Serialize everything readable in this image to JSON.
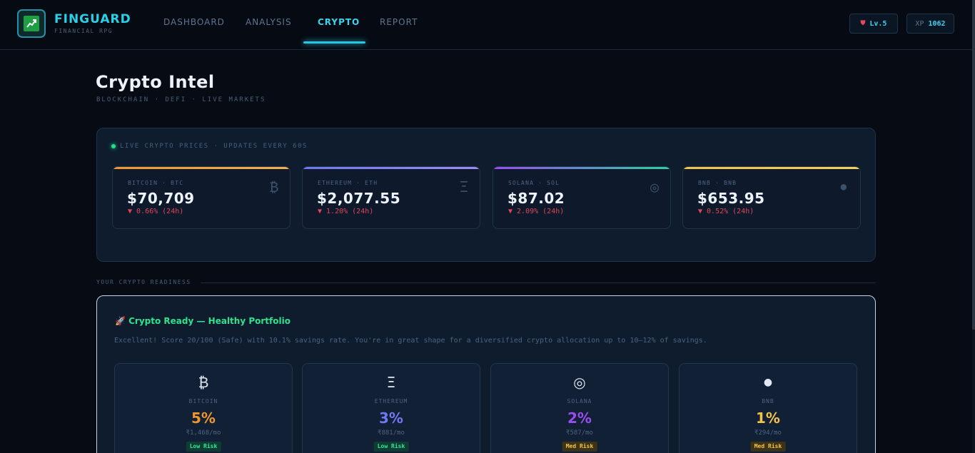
{
  "brand": {
    "name": "FINGUARD",
    "subtitle": "FINANCIAL RPG"
  },
  "nav": {
    "tabs": [
      {
        "label": "DASHBOARD",
        "active": false
      },
      {
        "label": "ANALYSIS",
        "active": false
      },
      {
        "label": "CRYPTO",
        "active": true
      },
      {
        "label": "REPORT",
        "active": false
      }
    ]
  },
  "status": {
    "level": "Lv.5",
    "xp_label": "XP",
    "xp_value": "1062"
  },
  "page": {
    "title": "Crypto Intel",
    "subtitle": "BLOCKCHAIN · DEFI · LIVE MARKETS"
  },
  "live": {
    "label": "LIVE CRYPTO PRICES · UPDATES EVERY 60S",
    "coins": [
      {
        "name": "BITCOIN · BTC",
        "price": "$70,709",
        "change": "▼ 0.66% (24h)",
        "icon": "₿",
        "accent": "#f0962e"
      },
      {
        "name": "ETHEREUM · ETH",
        "price": "$2,077.55",
        "change": "▼ 1.20% (24h)",
        "icon": "Ξ",
        "accent": "#7b74f0"
      },
      {
        "name": "SOLANA · SOL",
        "price": "$87.02",
        "change": "▼ 2.09% (24h)",
        "icon": "◎",
        "accent": "#8b3df0"
      },
      {
        "name": "BNB · BNB",
        "price": "$653.95",
        "change": "▼ 0.52% (24h)",
        "icon": "●",
        "accent": "#f2c24a"
      }
    ]
  },
  "readiness": {
    "section_label": "YOUR CRYPTO READINESS",
    "title": "🚀 Crypto Ready — Healthy Portfolio",
    "description": "Excellent! Score 20/100 (Safe) with 10.1% savings rate. You're in great shape for a diversified crypto allocation up to 10–12% of savings.",
    "allocations": [
      {
        "icon": "₿",
        "name": "BITCOIN",
        "percent": "5%",
        "amount": "₹1,468/mo",
        "risk": "Low Risk",
        "color": "#f0962e"
      },
      {
        "icon": "Ξ",
        "name": "ETHEREUM",
        "percent": "3%",
        "amount": "₹881/mo",
        "risk": "Low Risk",
        "color": "#6f78f0"
      },
      {
        "icon": "◎",
        "name": "SOLANA",
        "percent": "2%",
        "amount": "₹587/mo",
        "risk": "Med Risk",
        "color": "#9a4cf2"
      },
      {
        "icon": "●",
        "name": "BNB",
        "percent": "1%",
        "amount": "₹294/mo",
        "risk": "Med Risk",
        "color": "#f2c24a"
      }
    ]
  }
}
